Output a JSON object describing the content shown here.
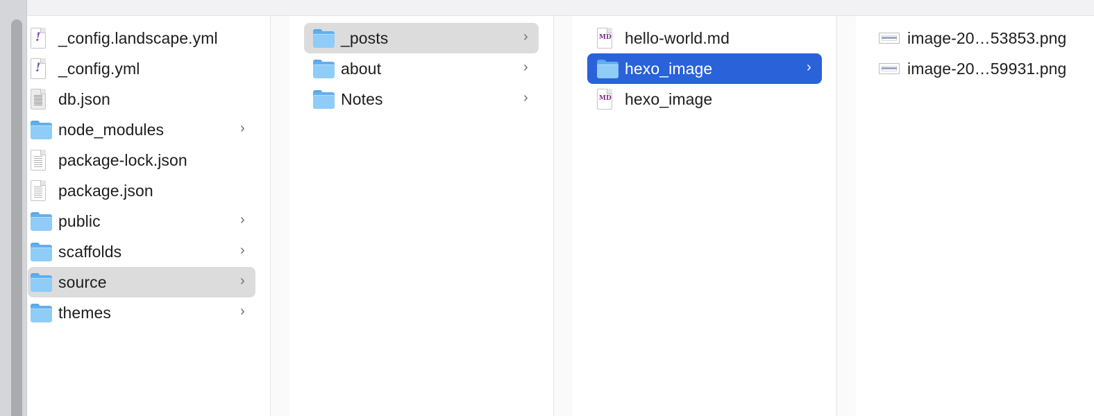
{
  "columns": [
    {
      "items": [
        {
          "label": "_config.landscape.yml",
          "icon": "yaml-file-icon",
          "folder": false
        },
        {
          "label": "_config.yml",
          "icon": "yaml-file-icon",
          "folder": false
        },
        {
          "label": "db.json",
          "icon": "json-file-icon",
          "folder": false
        },
        {
          "label": "node_modules",
          "icon": "folder-icon",
          "folder": true
        },
        {
          "label": "package-lock.json",
          "icon": "document-icon",
          "folder": false
        },
        {
          "label": "package.json",
          "icon": "document-icon",
          "folder": false
        },
        {
          "label": "public",
          "icon": "folder-icon",
          "folder": true
        },
        {
          "label": "scaffolds",
          "icon": "folder-icon",
          "folder": true
        },
        {
          "label": "source",
          "icon": "folder-icon",
          "folder": true,
          "selected": "inactive"
        },
        {
          "label": "themes",
          "icon": "folder-icon",
          "folder": true
        }
      ]
    },
    {
      "items": [
        {
          "label": "_posts",
          "icon": "folder-icon",
          "folder": true,
          "selected": "inactive"
        },
        {
          "label": "about",
          "icon": "folder-icon",
          "folder": true
        },
        {
          "label": "Notes",
          "icon": "folder-icon",
          "folder": true
        }
      ]
    },
    {
      "items": [
        {
          "label": "hello-world.md",
          "icon": "markdown-file-icon",
          "folder": false
        },
        {
          "label": "hexo_image",
          "icon": "folder-icon",
          "folder": true,
          "selected": "active"
        },
        {
          "label": "hexo_image",
          "icon": "markdown-file-icon",
          "folder": false
        }
      ]
    },
    {
      "items": [
        {
          "label": "image-20…53853.png",
          "icon": "image-thumbnail-icon",
          "folder": false
        },
        {
          "label": "image-20…59931.png",
          "icon": "image-thumbnail-icon",
          "folder": false
        }
      ]
    }
  ],
  "colors": {
    "selection_active": "#2962d9",
    "selection_inactive": "#dcdcdc",
    "folder": "#62b0ee"
  }
}
